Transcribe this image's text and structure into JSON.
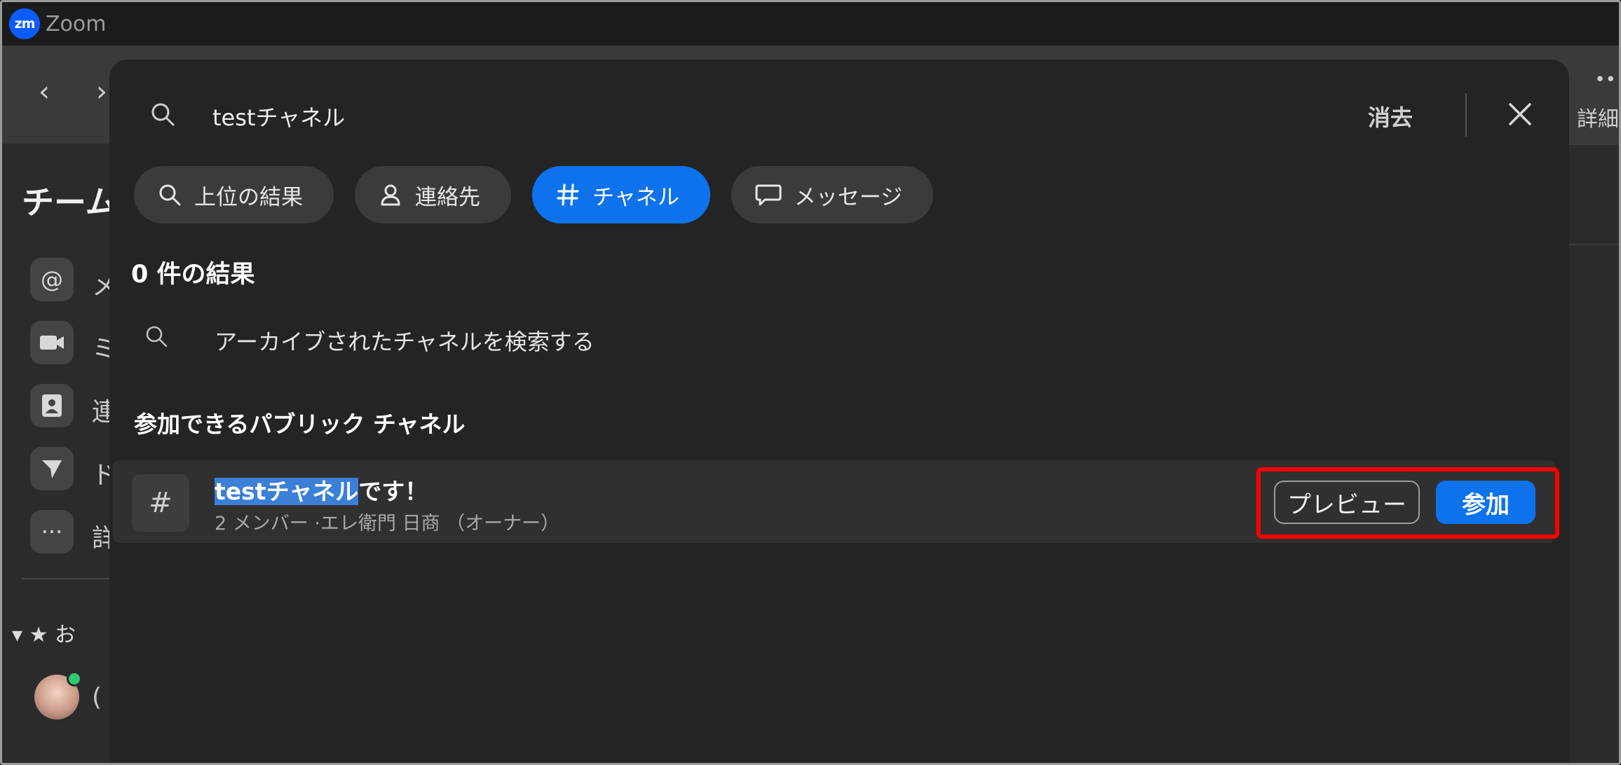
{
  "window": {
    "app_logo": "zm",
    "app_title": "Zoom"
  },
  "background": {
    "team_title": "チーム",
    "sidebar_labels": [
      "メ",
      "ミ",
      "連",
      "ド",
      "詳"
    ],
    "favorites_label": "お",
    "contact_label": "(",
    "right_label": "詳細"
  },
  "search": {
    "query": "testチャネル",
    "clear_label": "消去"
  },
  "tabs": [
    {
      "label": "上位の結果",
      "icon": "search-icon"
    },
    {
      "label": "連絡先",
      "icon": "person-icon"
    },
    {
      "label": "チャネル",
      "icon": "hash-icon",
      "active": true
    },
    {
      "label": "メッセージ",
      "icon": "chat-bubble-icon"
    }
  ],
  "results": {
    "count_label": "0 件の結果",
    "archive_search_label": "アーカイブされたチャネルを検索する",
    "section_heading": "参加できるパブリック チャネル"
  },
  "channel": {
    "name_highlight": "testチャネル",
    "name_rest": "です！",
    "meta": "2 メンバー ·エレ衛門 日商 （オーナー）",
    "preview_label": "プレビュー",
    "join_label": "参加"
  },
  "colors": {
    "accent": "#0e72ed",
    "highlight_box": "#ff0000"
  }
}
